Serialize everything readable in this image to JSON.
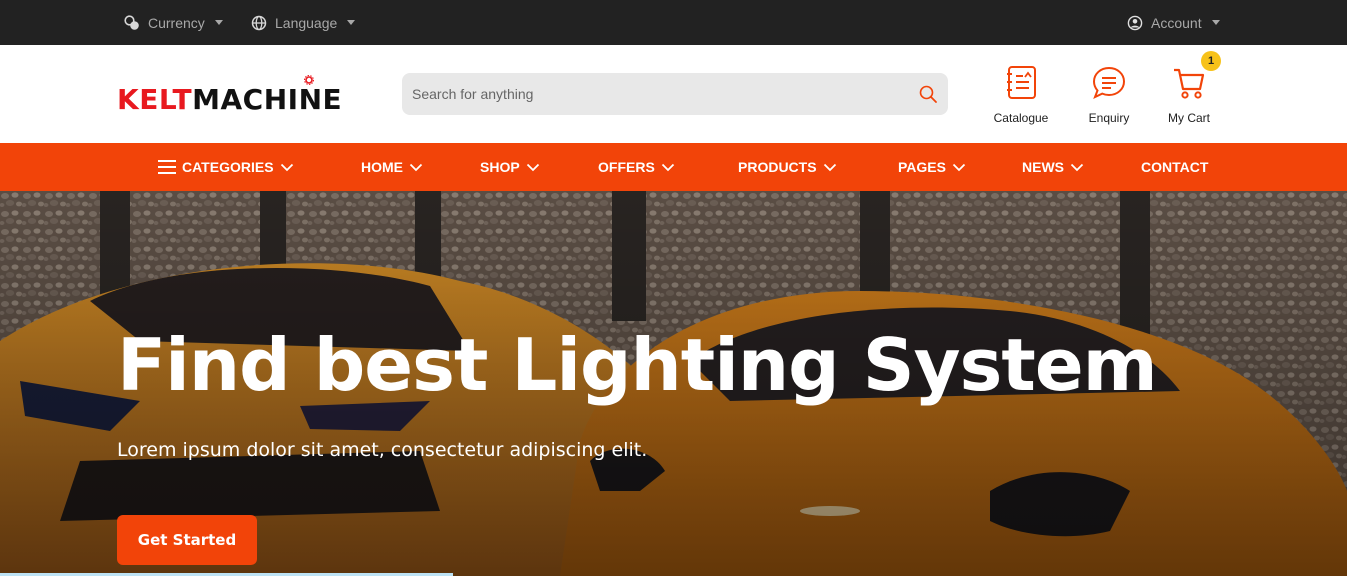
{
  "topbar": {
    "currency_label": "Currency",
    "language_label": "Language",
    "account_label": "Account"
  },
  "header": {
    "logo_part1": "KELT",
    "logo_part2": "MACHINE",
    "search_placeholder": "Search for anything",
    "catalogue_label": "Catalogue",
    "enquiry_label": "Enquiry",
    "cart_label": "My Cart",
    "cart_count": "1"
  },
  "nav": {
    "categories": "CATEGORIES",
    "items": [
      "HOME",
      "SHOP",
      "OFFERS",
      "PRODUCTS",
      "PAGES",
      "NEWS",
      "CONTACT"
    ]
  },
  "hero": {
    "title": "Find best Lighting System",
    "subtitle": "Lorem ipsum dolor sit amet, consectetur adipiscing elit.",
    "button_label": "Get Started"
  },
  "colors": {
    "accent": "#f24409",
    "topbar_bg": "#222222",
    "logo_red": "#e8191f",
    "badge": "#f7c21a"
  },
  "icons": [
    "currency-icon",
    "globe-icon",
    "account-icon",
    "search-icon",
    "catalogue-icon",
    "enquiry-icon",
    "cart-icon",
    "menu-icon",
    "chevron-down-icon"
  ]
}
